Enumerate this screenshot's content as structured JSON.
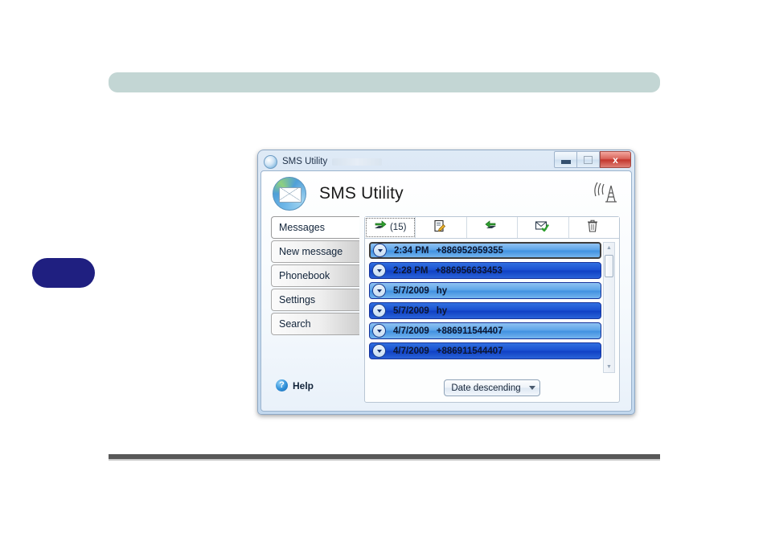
{
  "page": {
    "header_bar_color": "#c3d6d4",
    "side_tab_color": "#1f1f80",
    "footer_rule_color": "#585858"
  },
  "window": {
    "title": "SMS Utility",
    "icon": "sms-globe-icon",
    "controls": {
      "minimize": "minimize-button",
      "maximize": "maximize-button",
      "close_label": "x"
    }
  },
  "app": {
    "heading": "SMS Utility",
    "logo_icon": "globe-envelope-icon",
    "signal_icon": "antenna-tower-icon"
  },
  "sidebar": {
    "items": [
      {
        "label": "Messages",
        "active": true
      },
      {
        "label": "New message",
        "active": false
      },
      {
        "label": "Phonebook",
        "active": false
      },
      {
        "label": "Settings",
        "active": false
      },
      {
        "label": "Search",
        "active": false
      }
    ],
    "help": {
      "label": "Help",
      "icon": "question-mark-icon",
      "badge": "?"
    }
  },
  "panel": {
    "tabs": [
      {
        "name": "inbox",
        "icon": "inbox-arrow-icon",
        "count": "(15)",
        "active": true
      },
      {
        "name": "drafts",
        "icon": "draft-pencil-icon",
        "count": "",
        "active": false
      },
      {
        "name": "outbox",
        "icon": "outbox-arrow-icon",
        "count": "",
        "active": false
      },
      {
        "name": "sent",
        "icon": "sent-check-icon",
        "count": "",
        "active": false
      },
      {
        "name": "trash",
        "icon": "trash-bin-icon",
        "count": "",
        "active": false
      }
    ],
    "messages": [
      {
        "time": "2:34 PM",
        "sender": "+886952959355",
        "style": "light",
        "selected": true
      },
      {
        "time": "2:28 PM",
        "sender": "+886956633453",
        "style": "dark",
        "selected": false
      },
      {
        "time": "5/7/2009",
        "sender": "hy",
        "style": "light",
        "selected": false
      },
      {
        "time": "5/7/2009",
        "sender": "hy",
        "style": "dark",
        "selected": false
      },
      {
        "time": "4/7/2009",
        "sender": "+886911544407",
        "style": "light",
        "selected": false
      },
      {
        "time": "4/7/2009",
        "sender": "+886911544407",
        "style": "dark",
        "selected": false
      }
    ],
    "sort": {
      "value": "Date descending"
    },
    "scrollbar": {
      "up": "▲",
      "down": "▼"
    }
  }
}
